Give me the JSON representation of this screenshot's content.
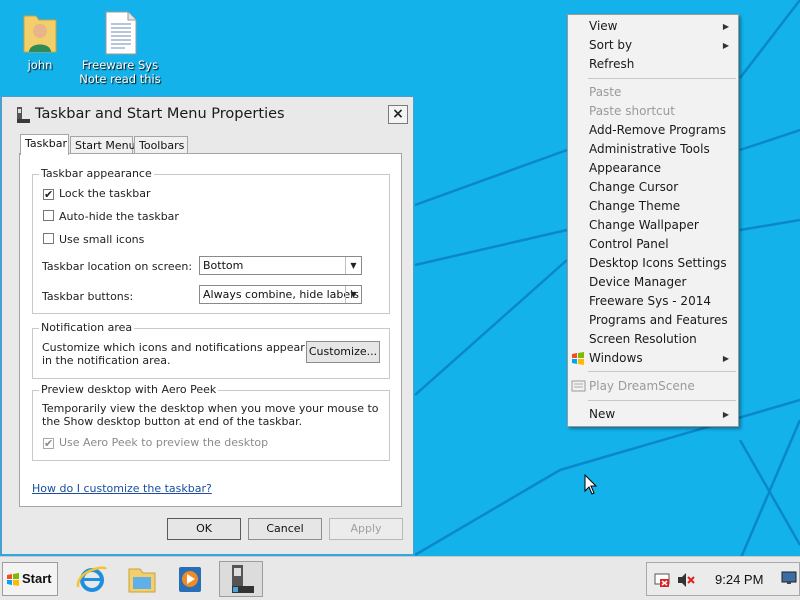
{
  "desktop": {
    "icons": [
      {
        "label": "john",
        "icon": "user-folder-icon"
      },
      {
        "label_line1": "Freeware Sys",
        "label_line2": "Note read this",
        "icon": "text-document-icon"
      }
    ]
  },
  "dialog": {
    "title": "Taskbar and Start Menu Properties",
    "close_label": "×",
    "tabs": [
      "Taskbar",
      "Start Menu",
      "Toolbars"
    ],
    "active_tab": "Taskbar",
    "appearance": {
      "group_title": "Taskbar appearance",
      "checkboxes": [
        {
          "label": "Lock the taskbar",
          "checked": true,
          "mark": "✔"
        },
        {
          "label": "Auto-hide the taskbar",
          "checked": false,
          "mark": ""
        },
        {
          "label": "Use small icons",
          "checked": false,
          "mark": ""
        }
      ],
      "location_label": "Taskbar location on screen:",
      "location_value": "Bottom",
      "buttons_label": "Taskbar buttons:",
      "buttons_value": "Always combine, hide labels"
    },
    "notification": {
      "group_title": "Notification area",
      "description": "Customize which icons and notifications appear in the notification area.",
      "customize_label": "Customize..."
    },
    "peek": {
      "group_title": "Preview desktop with Aero Peek",
      "description": "Temporarily view the desktop when you move your mouse to the Show desktop button at end of the taskbar.",
      "checkbox_label": "Use Aero Peek to preview the desktop",
      "checkbox_mark": "✔",
      "checked": true,
      "disabled": true
    },
    "help_link": "How do I customize the taskbar?",
    "ok_label": "OK",
    "cancel_label": "Cancel",
    "apply_label": "Apply"
  },
  "context_menu": {
    "items": [
      {
        "label": "View",
        "submenu": true,
        "disabled": false
      },
      {
        "label": "Sort by",
        "submenu": true,
        "disabled": false
      },
      {
        "label": "Refresh",
        "submenu": false,
        "disabled": false
      },
      {
        "label": "Paste",
        "submenu": false,
        "disabled": true
      },
      {
        "label": "Paste shortcut",
        "submenu": false,
        "disabled": true
      },
      {
        "label": "Add-Remove Programs",
        "submenu": false,
        "disabled": false
      },
      {
        "label": "Administrative Tools",
        "submenu": false,
        "disabled": false
      },
      {
        "label": "Appearance",
        "submenu": false,
        "disabled": false
      },
      {
        "label": "Change Cursor",
        "submenu": false,
        "disabled": false
      },
      {
        "label": "Change Theme",
        "submenu": false,
        "disabled": false
      },
      {
        "label": "Change Wallpaper",
        "submenu": false,
        "disabled": false
      },
      {
        "label": "Control Panel",
        "submenu": false,
        "disabled": false
      },
      {
        "label": "Desktop Icons Settings",
        "submenu": false,
        "disabled": false
      },
      {
        "label": "Device Manager",
        "submenu": false,
        "disabled": false
      },
      {
        "label": "Freeware Sys - 2014",
        "submenu": false,
        "disabled": false
      },
      {
        "label": "Programs and Features",
        "submenu": false,
        "disabled": false
      },
      {
        "label": "Screen Resolution",
        "submenu": false,
        "disabled": false
      },
      {
        "label": "Windows",
        "submenu": true,
        "disabled": false,
        "icon": "windows-logo-icon"
      },
      {
        "label": "Play DreamScene",
        "submenu": false,
        "disabled": true,
        "icon": "dreamscene-icon"
      },
      {
        "label": "New",
        "submenu": true,
        "disabled": false
      }
    ],
    "submenu_arrow": "▶"
  },
  "taskbar": {
    "start_label": "Start",
    "pinned": [
      "internet-explorer-icon",
      "file-explorer-icon",
      "media-player-icon",
      "taskbar-properties-icon"
    ],
    "tray_icons": [
      "action-center-icon",
      "volume-muted-icon"
    ],
    "clock": "9:24 PM"
  },
  "colors": {
    "desktop_bg": "#14b2ea",
    "accent": "#4a9fd1"
  }
}
